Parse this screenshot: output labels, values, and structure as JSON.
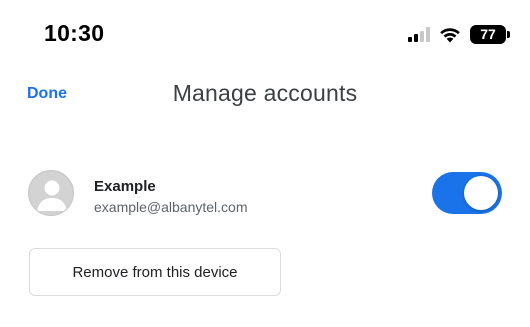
{
  "status_bar": {
    "time": "10:30",
    "battery_level": "77",
    "icons": [
      "signal-icon",
      "wifi-icon",
      "battery-icon"
    ]
  },
  "header": {
    "done_label": "Done",
    "title": "Manage accounts"
  },
  "account": {
    "name": "Example",
    "email": "example@albanytel.com",
    "enabled": true,
    "avatar_icon": "default-avatar-icon"
  },
  "actions": {
    "remove_label": "Remove from this device"
  },
  "colors": {
    "accent": "#1a73e8",
    "toggle_on": "#1a73e8",
    "avatar_bg": "#d3d3d3"
  }
}
